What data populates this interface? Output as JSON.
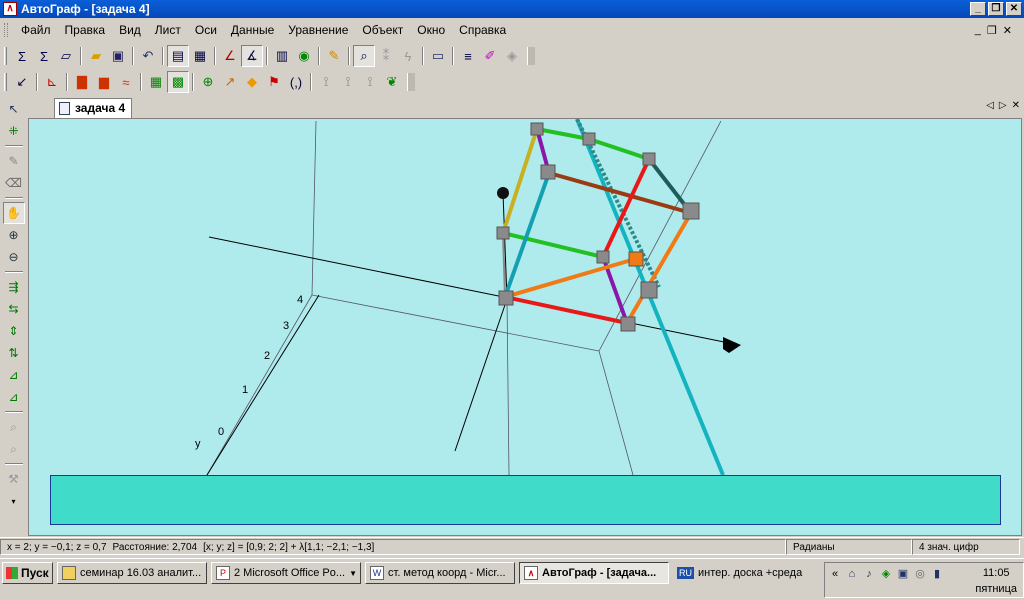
{
  "window": {
    "title": "АвтоГраф - [задача 4]",
    "icon": "autograph-icon",
    "buttons": [
      "minimize",
      "restore",
      "close"
    ]
  },
  "menu": {
    "items": [
      "Файл",
      "Правка",
      "Вид",
      "Лист",
      "Оси",
      "Данные",
      "Уравнение",
      "Объект",
      "Окно",
      "Справка"
    ],
    "mdi_buttons": [
      "minimize",
      "restore",
      "close"
    ]
  },
  "toolbar1": {
    "icons": [
      "sigma-icon",
      "sigma-list-icon",
      "graph-icon",
      "open-folder-icon",
      "save-icon",
      "undo-icon",
      "page-layout-icon",
      "zoom-page-icon",
      "triangle-icon",
      "angle-icon",
      "table-icon",
      "globe-icon",
      "pencil-icon",
      "zoom-icon",
      "slow-plot-icon",
      "lightning-icon",
      "projector-icon",
      "line-style-icon",
      "color-icon",
      "fill-icon"
    ]
  },
  "toolbar2": {
    "icons": [
      "axes-icon",
      "axes-2d-icon",
      "gradient-icon",
      "plane-icon",
      "wave-icon",
      "grid-icon",
      "grid-select-icon",
      "point-add-icon",
      "vector-icon",
      "rubber-icon",
      "point-flag-icon",
      "parentheses-icon",
      "transform-icon",
      "transform-2-icon",
      "transform-3-icon",
      "turtle-icon"
    ],
    "parentheses_label": "(,)"
  },
  "left_toolbar": {
    "icons": [
      "select-arrow-icon",
      "add-point-icon",
      "pencil-icon",
      "eraser-icon",
      "hand-icon",
      "zoom-in-icon",
      "zoom-out-icon",
      "move-icon",
      "rotate-icon",
      "scale-icon",
      "reflect-icon",
      "plot-icon",
      "plot-2-icon",
      "lens-icon",
      "lens-2-icon",
      "tools-icon"
    ]
  },
  "document_tab": {
    "label": "задача 4"
  },
  "axes_labels": {
    "y_ticks": [
      "0",
      "1",
      "2",
      "3",
      "4"
    ],
    "y_label": "y"
  },
  "status_bar": {
    "coordinates": "x = 2; y = −0,1; z = 0,7",
    "distance": "Расстояние: 2,704",
    "line": "[x; y; z] = [0,9; 2; 2] + λ[1,1; −2,1; −1,3]",
    "angle_mode": "Радианы",
    "precision": "4 знач. цифр"
  },
  "taskbar": {
    "start_label": "Пуск",
    "buttons": [
      {
        "label": "семинар 16.03 аналит...",
        "icon": "folder-icon",
        "active": false
      },
      {
        "label": "2 Microsoft Office Po...",
        "icon": "powerpoint-icon",
        "active": false
      },
      {
        "label": "ст. метод коорд - Micr...",
        "icon": "word-icon",
        "active": false
      },
      {
        "label": "АвтоГраф - [задача...",
        "icon": "autograph-icon",
        "active": true
      }
    ],
    "lang": "RU",
    "lang_text": "интер. доска +среда",
    "clock_time": "11:05",
    "clock_day": "пятница"
  },
  "colors": {
    "canvas_bg": "#afebed",
    "textbox_bg": "#40dbc9",
    "title_bar": "#0a5fd8"
  }
}
